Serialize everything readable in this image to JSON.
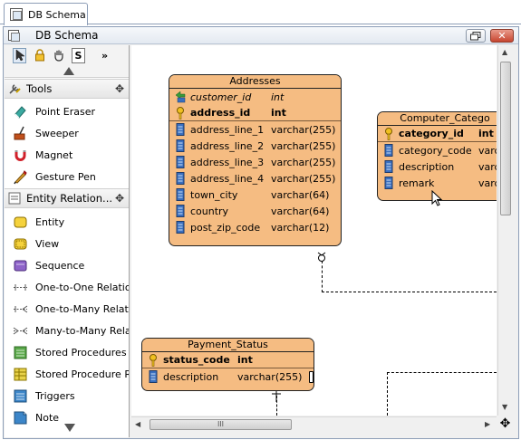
{
  "outer_tab": {
    "label": "DB Schema"
  },
  "window": {
    "title": "DB Schema"
  },
  "palette": {
    "tools_header": "Tools",
    "tools": [
      {
        "label": "Point Eraser",
        "icon": "eraser-icon"
      },
      {
        "label": "Sweeper",
        "icon": "sweeper-icon"
      },
      {
        "label": "Magnet",
        "icon": "magnet-icon"
      },
      {
        "label": "Gesture Pen",
        "icon": "pen-icon"
      }
    ],
    "entity_header": "Entity Relation...",
    "entity_items": [
      {
        "label": "Entity",
        "icon": "entity-icon"
      },
      {
        "label": "View",
        "icon": "view-icon"
      },
      {
        "label": "Sequence",
        "icon": "sequence-icon"
      },
      {
        "label": "One-to-One Relations",
        "icon": "one-to-one-icon"
      },
      {
        "label": "One-to-Many Relation",
        "icon": "one-to-many-icon"
      },
      {
        "label": "Many-to-Many Relati",
        "icon": "many-to-many-icon"
      },
      {
        "label": "Stored Procedures",
        "icon": "stored-procedures-icon"
      },
      {
        "label": "Stored Procedure Res",
        "icon": "stored-procedure-result-icon"
      },
      {
        "label": "Triggers",
        "icon": "triggers-icon"
      },
      {
        "label": "Note",
        "icon": "note-icon"
      }
    ],
    "toolbar_s_label": "S",
    "toolbar_more": "»"
  },
  "entities": {
    "addresses": {
      "name": "Addresses",
      "columns": [
        {
          "name": "customer_id",
          "type": "int",
          "kind": "fk"
        },
        {
          "name": "address_id",
          "type": "int",
          "kind": "pk"
        },
        {
          "name": "address_line_1",
          "type": "varchar(255)",
          "kind": "col"
        },
        {
          "name": "address_line_2",
          "type": "varchar(255)",
          "kind": "col"
        },
        {
          "name": "address_line_3",
          "type": "varchar(255)",
          "kind": "col"
        },
        {
          "name": "address_line_4",
          "type": "varchar(255)",
          "kind": "col"
        },
        {
          "name": "town_city",
          "type": "varchar(64)",
          "kind": "col"
        },
        {
          "name": "country",
          "type": "varchar(64)",
          "kind": "col"
        },
        {
          "name": "post_zip_code",
          "type": "varchar(12)",
          "kind": "col"
        }
      ]
    },
    "computer_category": {
      "name": "Computer_Catego",
      "columns": [
        {
          "name": "category_id",
          "type": "int",
          "kind": "pk"
        },
        {
          "name": "category_code",
          "type": "varchar",
          "kind": "col"
        },
        {
          "name": "description",
          "type": "varchar",
          "kind": "col"
        },
        {
          "name": "remark",
          "type": "varchar",
          "kind": "col"
        }
      ]
    },
    "payment_status": {
      "name": "Payment_Status",
      "columns": [
        {
          "name": "status_code",
          "type": "int",
          "kind": "pk"
        },
        {
          "name": "description",
          "type": "varchar(255)",
          "kind": "col"
        }
      ]
    }
  },
  "scroll": {
    "h_thumb_grip": "III"
  },
  "colors": {
    "entity_fill": "#f5bc82",
    "canvas": "#ffffff"
  }
}
